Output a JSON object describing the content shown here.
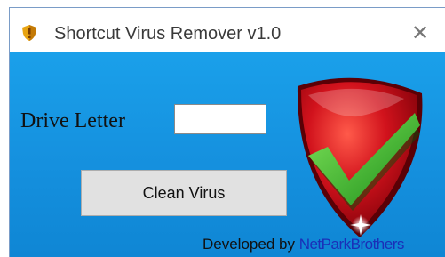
{
  "window": {
    "title": "Shortcut Virus Remover v1.0",
    "close_glyph": "✕",
    "app_icon": "shield-icon"
  },
  "form": {
    "drive_label": "Drive Letter",
    "drive_value": "",
    "clean_button_label": "Clean Virus"
  },
  "footer": {
    "prefix": "Developed by",
    "brand": "NetParkBrothers"
  },
  "logo": {
    "icon": "shield-checkmark-logo",
    "colors": {
      "shield": "#c8101a",
      "check": "#2fb52a"
    }
  },
  "colors": {
    "background": "#1590de",
    "button": "#e1e1e1",
    "brand_text": "#1a2fb8"
  }
}
